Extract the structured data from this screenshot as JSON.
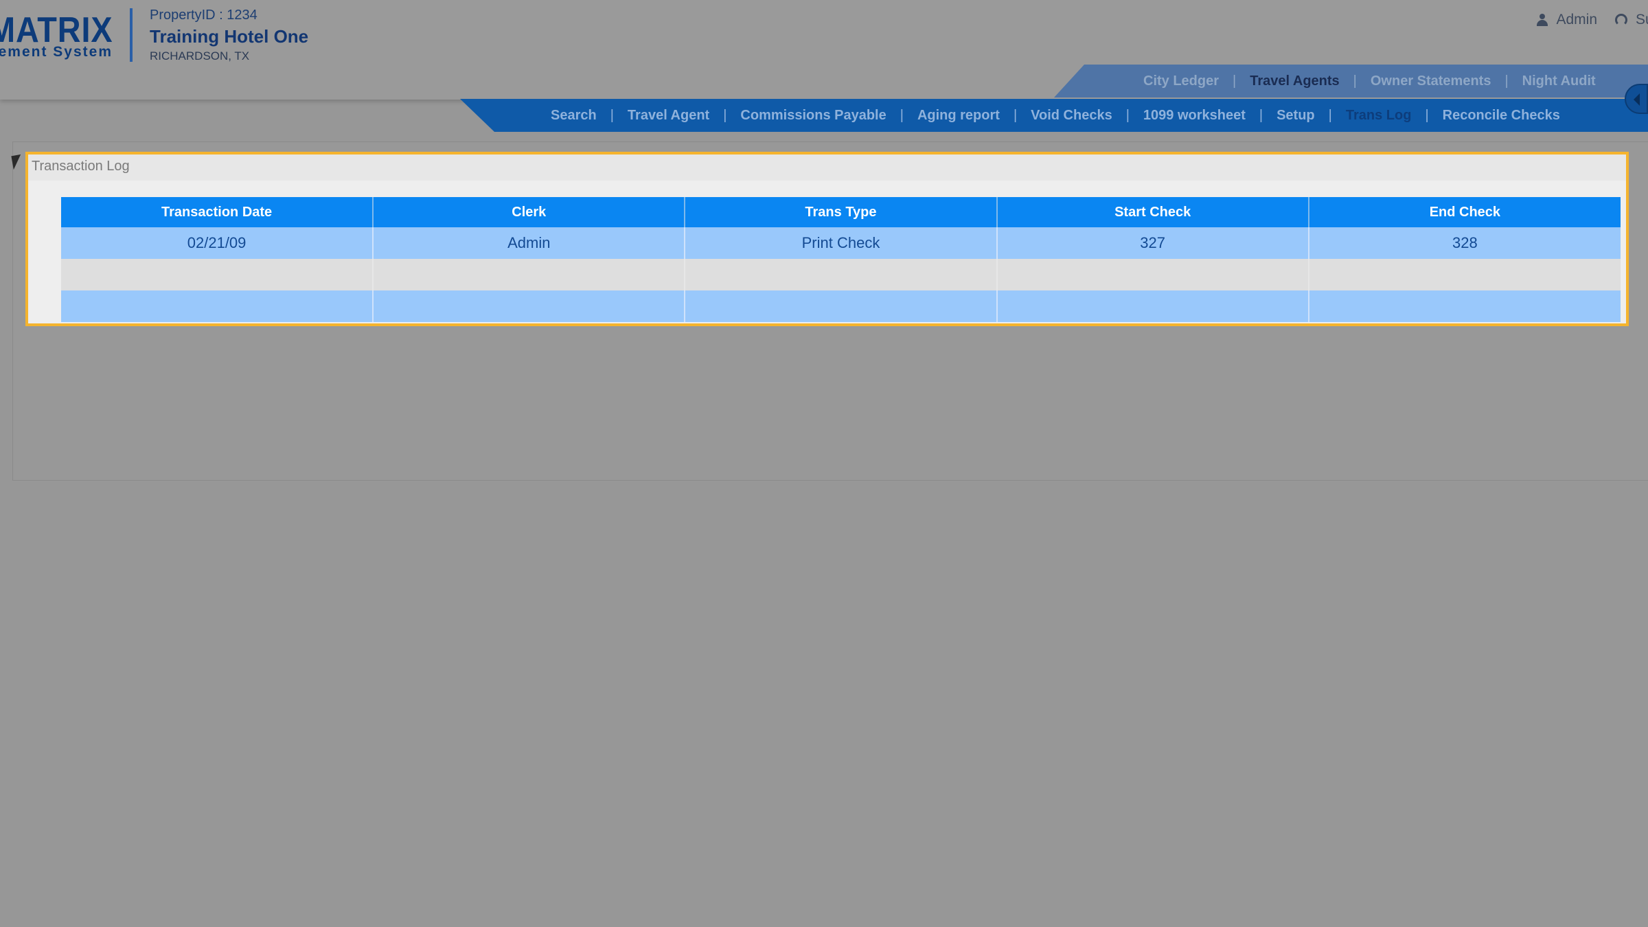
{
  "brand": {
    "title": "MATRIX",
    "subtitle": "gement System"
  },
  "property": {
    "id_label": "PropertyID : 1234",
    "hotel_name": "Training Hotel One",
    "city": "RICHARDSON, TX"
  },
  "user": {
    "name": "Admin",
    "support_label": "Su"
  },
  "top_tabs": [
    {
      "label": "City Ledger",
      "active": false
    },
    {
      "label": "Travel Agents",
      "active": true
    },
    {
      "label": "Owner Statements",
      "active": false
    },
    {
      "label": "Night Audit",
      "active": false
    }
  ],
  "main_nav": [
    {
      "label": "Search",
      "active": false
    },
    {
      "label": "Travel Agent",
      "active": false
    },
    {
      "label": "Commissions Payable",
      "active": false
    },
    {
      "label": "Aging report",
      "active": false
    },
    {
      "label": "Void Checks",
      "active": false
    },
    {
      "label": "1099 worksheet",
      "active": false
    },
    {
      "label": "Setup",
      "active": false
    },
    {
      "label": "Trans Log",
      "active": true
    },
    {
      "label": "Reconcile Checks",
      "active": false
    }
  ],
  "separator": "|",
  "transaction_log": {
    "title": "Transaction Log",
    "columns": [
      "Transaction Date",
      "Clerk",
      "Trans Type",
      "Start Check",
      "End Check"
    ],
    "rows": [
      [
        "02/21/09",
        "Admin",
        "Print Check",
        "327",
        "328"
      ],
      [
        "",
        "",
        "",
        "",
        ""
      ],
      [
        "",
        "",
        "",
        "",
        ""
      ]
    ]
  },
  "colors": {
    "header_bg": "#9a9a9a",
    "main_nav_bg": "#0f5aa8",
    "top_tabs_bg": "#4f74a6",
    "table_header_bg": "#0a86f2",
    "row_highlight": "#99c8fb",
    "focus_border": "#f5b42e"
  }
}
